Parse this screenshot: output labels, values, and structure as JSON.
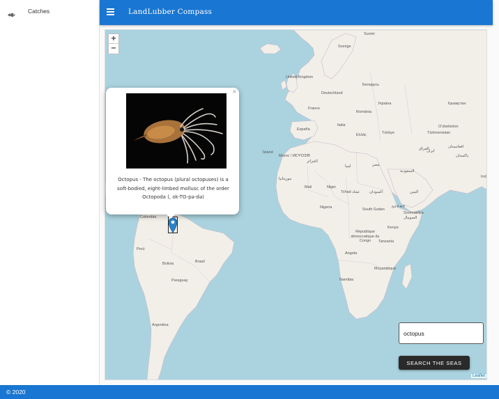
{
  "app": {
    "title": "LandLubber Compass"
  },
  "sidebar": {
    "items": [
      {
        "label": "Catches",
        "icon": "fish-icon"
      }
    ]
  },
  "map": {
    "zoom_in": "+",
    "zoom_out": "−",
    "attribution": "Leaflet",
    "places": [
      {
        "id": "suomi",
        "label": "Suomi"
      },
      {
        "id": "sverige",
        "label": "Sverige"
      },
      {
        "id": "island",
        "label": "Ísland"
      },
      {
        "id": "uk",
        "label": "United Kingdom"
      },
      {
        "id": "deutschland",
        "label": "Deutschland"
      },
      {
        "id": "belarus",
        "label": "Беларусь"
      },
      {
        "id": "ukraina",
        "label": "Україна"
      },
      {
        "id": "kazakhstan",
        "label": "Қазақстан"
      },
      {
        "id": "france",
        "label": "France"
      },
      {
        "id": "romania",
        "label": "România"
      },
      {
        "id": "espana",
        "label": "España"
      },
      {
        "id": "italia",
        "label": "Italia"
      },
      {
        "id": "ellas",
        "label": "Ελλάς"
      },
      {
        "id": "turkiye",
        "label": "Türkiye"
      },
      {
        "id": "ozbekiston",
        "label": "O'zbekiston"
      },
      {
        "id": "turkmenistan",
        "label": "Türkmenistan"
      },
      {
        "id": "iraq",
        "label": "العراق"
      },
      {
        "id": "iran",
        "label": "ایران"
      },
      {
        "id": "afghanistan",
        "label": "افغانستان"
      },
      {
        "id": "pakistan",
        "label": "پاکستان"
      },
      {
        "id": "maroc",
        "label": "Maroc / ⵍⵎⵖⵔⵉⴱ"
      },
      {
        "id": "algerie",
        "label": "الجزائر"
      },
      {
        "id": "libya",
        "label": "ليبيا"
      },
      {
        "id": "misr",
        "label": "مصر"
      },
      {
        "id": "saudi",
        "label": "السعودية"
      },
      {
        "id": "india",
        "label": "Indi"
      },
      {
        "id": "mauritania",
        "label": "موريتانيا"
      },
      {
        "id": "mali",
        "label": "Mali"
      },
      {
        "id": "niger",
        "label": "Niger"
      },
      {
        "id": "tchad",
        "label": "Tchad تشاد"
      },
      {
        "id": "sudan",
        "label": "السودان"
      },
      {
        "id": "yemen",
        "label": "اليمن"
      },
      {
        "id": "nigeria",
        "label": "Nigeria"
      },
      {
        "id": "southsudan",
        "label": "South Sudan"
      },
      {
        "id": "ethiopia",
        "label": "ኢትዮጵያ"
      },
      {
        "id": "somalia",
        "label": "Soomaaliya الصومال"
      },
      {
        "id": "colombia",
        "label": "Colombia"
      },
      {
        "id": "kenya",
        "label": "Kenya"
      },
      {
        "id": "rdc",
        "label": "République démocratique du Congo"
      },
      {
        "id": "tanzania",
        "label": "Tanzania"
      },
      {
        "id": "peru",
        "label": "Perú"
      },
      {
        "id": "brasil",
        "label": "Brasil"
      },
      {
        "id": "angola",
        "label": "Angola"
      },
      {
        "id": "bolivia",
        "label": "Bolivia"
      },
      {
        "id": "mocambique",
        "label": "Moçambique"
      },
      {
        "id": "paraguay",
        "label": "Paraguay"
      },
      {
        "id": "namibia",
        "label": "Namibia"
      },
      {
        "id": "argentina",
        "label": "Argentina"
      }
    ]
  },
  "popup": {
    "close": "×",
    "description": "Octopus - The octopus (plural octopuses) is a soft-bodied, eight-limbed mollusc of the order Octopoda (, ok-TO-pə-də)"
  },
  "search": {
    "value": "octopus",
    "button_label": "SEARCH THE SEAS"
  },
  "footer": {
    "copyright": "© 2020"
  },
  "colors": {
    "primary": "#1976d2",
    "water": "#aad3df",
    "land": "#f2efe9",
    "button": "#2a2a2a"
  }
}
